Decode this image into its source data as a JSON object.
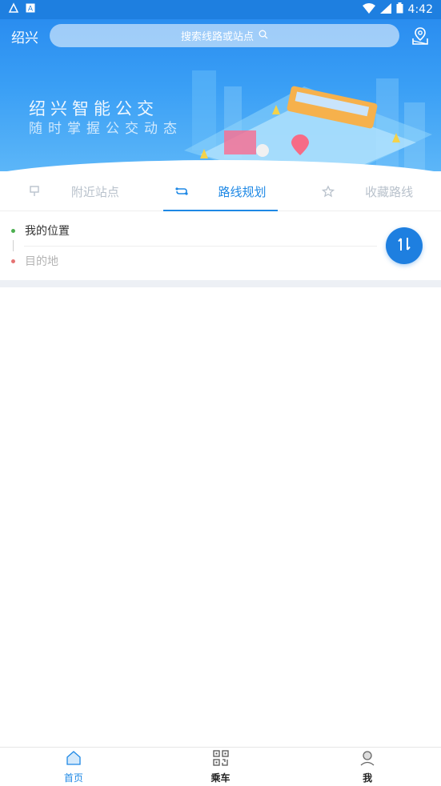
{
  "status_bar": {
    "time": "4:42",
    "icons": [
      "app-icon",
      "a-icon",
      "wifi-icon",
      "signal-icon",
      "battery-icon"
    ]
  },
  "header": {
    "city": "绍兴",
    "search_placeholder": "搜索线路或站点",
    "map_icon": "map-pin-icon"
  },
  "banner": {
    "title": "绍兴智能公交",
    "subtitle": "随时掌握公交动态"
  },
  "tabs": [
    {
      "label": "附近站点",
      "icon": "bus-stop-icon",
      "active": false
    },
    {
      "label": "路线规划",
      "icon": "route-icon",
      "active": true
    },
    {
      "label": "收藏路线",
      "icon": "star-icon",
      "active": false
    }
  ],
  "route_plan": {
    "from": "我的位置",
    "to_placeholder": "目的地",
    "swap_icon": "swap-icon"
  },
  "bottom_nav": [
    {
      "label": "首页",
      "icon": "home-icon",
      "active": true
    },
    {
      "label": "乘车",
      "icon": "qr-code-icon",
      "active": false
    },
    {
      "label": "我",
      "icon": "user-icon",
      "active": false
    }
  ],
  "colors": {
    "primary": "#1e88e5",
    "banner": "#2a8df0",
    "inactive_text": "#b9c2cc",
    "green_dot": "#4caf50",
    "red_dot": "#e57373"
  }
}
